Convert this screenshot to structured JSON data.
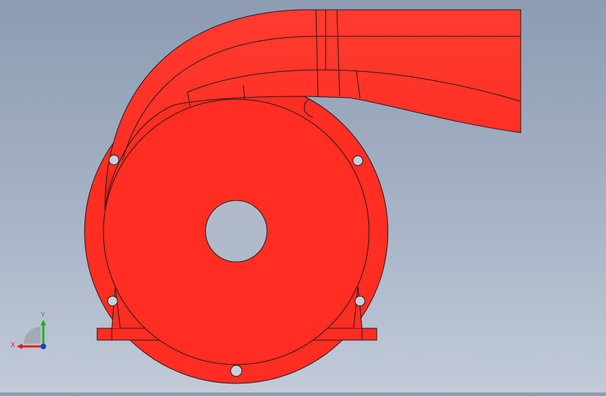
{
  "viewport": {
    "model": "pump-volute-housing",
    "part_color": "#ff2d22",
    "edge_color": "#1a1a1a",
    "background_top": "#8d9cb3",
    "background_bottom": "#c2cad8"
  },
  "triad": {
    "x_label": "X",
    "y_label": "Y",
    "x_color": "#e11b1b",
    "y_color": "#19b11b",
    "z_color": "#1f3bd8"
  }
}
